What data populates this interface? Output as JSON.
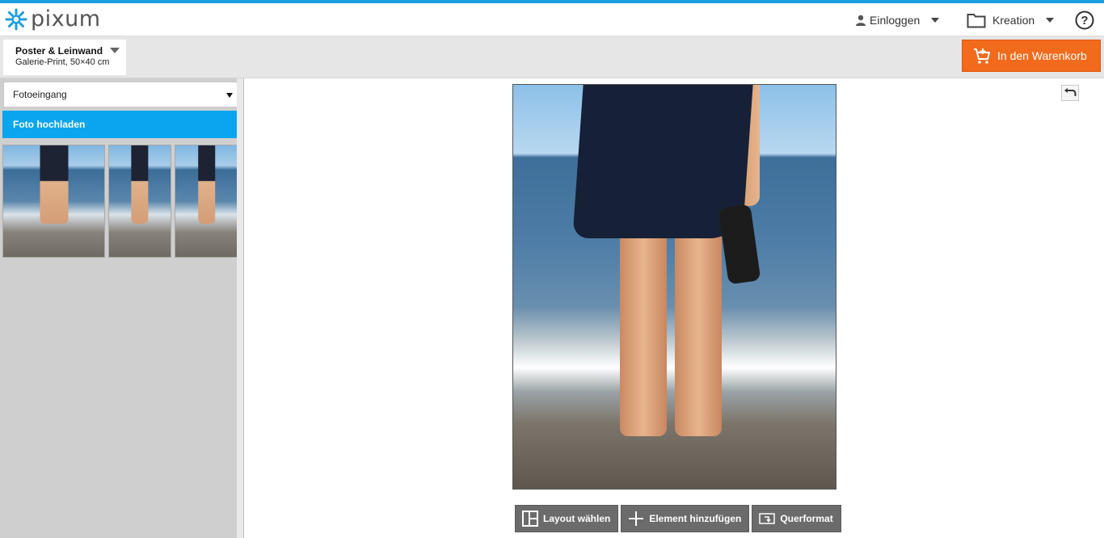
{
  "brand": {
    "name": "pixum"
  },
  "header": {
    "login_label": "Einloggen",
    "creation_label": "Kreation",
    "help_label": "?"
  },
  "product": {
    "title": "Poster & Leinwand",
    "subtitle": "Galerie-Print, 50×40 cm"
  },
  "cart": {
    "label": "In den Warenkorb"
  },
  "sidebar": {
    "folder_select": "Fotoeingang",
    "upload_label": "Foto hochladen",
    "thumbnails": [
      {
        "name": "thumbnail-1"
      },
      {
        "name": "thumbnail-2"
      },
      {
        "name": "thumbnail-3"
      }
    ]
  },
  "toolbar": {
    "layout_label": "Layout wählen",
    "add_element_label": "Element hinzufügen",
    "orientation_label": "Querformat"
  },
  "colors": {
    "accent": "#1a9ee0",
    "cart_orange": "#f26b1d",
    "upload_blue": "#0aa5ee",
    "toolbar_gray": "#6b6b6b"
  }
}
